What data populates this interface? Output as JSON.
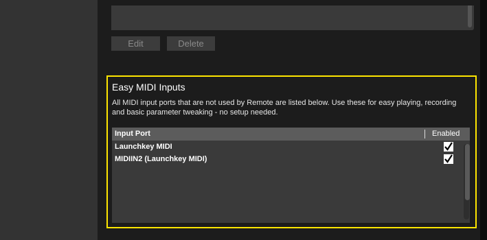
{
  "buttons": {
    "edit_label": "Edit",
    "delete_label": "Delete"
  },
  "easy_midi": {
    "title": "Easy MIDI Inputs",
    "description": "All MIDI input ports that are not used by Remote are listed below. Use these for easy playing, recording and basic parameter tweaking - no setup needed.",
    "columns": {
      "port": "Input Port",
      "enabled": "Enabled"
    },
    "rows": [
      {
        "port": "Launchkey MIDI",
        "enabled": true
      },
      {
        "port": "MIDIIN2 (Launchkey MIDI)",
        "enabled": true
      }
    ]
  },
  "colors": {
    "highlight_border": "#ffe600",
    "panel": "#333333",
    "background": "#1c1c1c"
  },
  "icons": {
    "checkbox_mark": "checkmark-icon"
  }
}
